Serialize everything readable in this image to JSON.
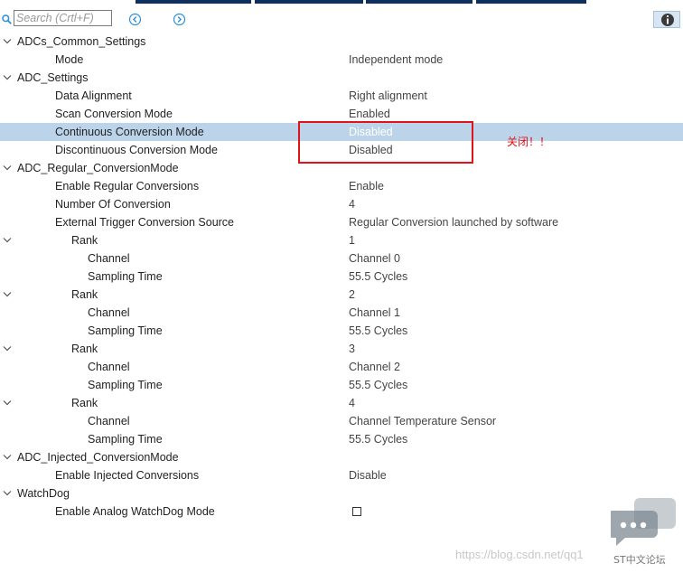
{
  "toolbar": {
    "search_placeholder": "Search (Crtl+F)"
  },
  "tree": [
    {
      "label": "ADCs_Common_Settings",
      "value": "",
      "expandable": true
    },
    {
      "label": "Mode",
      "value": "Independent mode"
    },
    {
      "label": "ADC_Settings",
      "value": "",
      "expandable": true
    },
    {
      "label": "Data Alignment",
      "value": "Right alignment"
    },
    {
      "label": "Scan Conversion Mode",
      "value": "Enabled"
    },
    {
      "label": "Continuous Conversion Mode",
      "value": "Disabled",
      "selected": true
    },
    {
      "label": "Discontinuous Conversion Mode",
      "value": "Disabled"
    },
    {
      "label": "ADC_Regular_ConversionMode",
      "value": "",
      "expandable": true
    },
    {
      "label": "Enable Regular Conversions",
      "value": "Enable"
    },
    {
      "label": "Number Of Conversion",
      "value": "4"
    },
    {
      "label": "External Trigger Conversion Source",
      "value": "Regular Conversion launched by software"
    },
    {
      "label": "Rank",
      "value": "1",
      "expandable": true
    },
    {
      "label": "Channel",
      "value": "Channel 0"
    },
    {
      "label": "Sampling Time",
      "value": "55.5 Cycles"
    },
    {
      "label": "Rank",
      "value": "2",
      "expandable": true
    },
    {
      "label": "Channel",
      "value": "Channel 1"
    },
    {
      "label": "Sampling Time",
      "value": "55.5 Cycles"
    },
    {
      "label": "Rank",
      "value": "3",
      "expandable": true
    },
    {
      "label": "Channel",
      "value": "Channel 2"
    },
    {
      "label": "Sampling Time",
      "value": "55.5 Cycles"
    },
    {
      "label": "Rank",
      "value": "4",
      "expandable": true
    },
    {
      "label": "Channel",
      "value": "Channel Temperature Sensor"
    },
    {
      "label": "Sampling Time",
      "value": "55.5 Cycles"
    },
    {
      "label": "ADC_Injected_ConversionMode",
      "value": "",
      "expandable": true
    },
    {
      "label": "Enable Injected Conversions",
      "value": "Disable"
    },
    {
      "label": "WatchDog",
      "value": "",
      "expandable": true
    },
    {
      "label": "Enable Analog WatchDog Mode",
      "value": "",
      "checkbox": true,
      "checked": false
    }
  ],
  "annotation": {
    "note": "关闭！！",
    "color": "#e0131a"
  },
  "watermark": {
    "url": "https://blog.csdn.net/qq1",
    "forum": "ST中文论坛"
  },
  "colors": {
    "selection": "#bcd4ea",
    "topbar": "#0f2f5c",
    "accent_icon": "#2a8fd6"
  }
}
